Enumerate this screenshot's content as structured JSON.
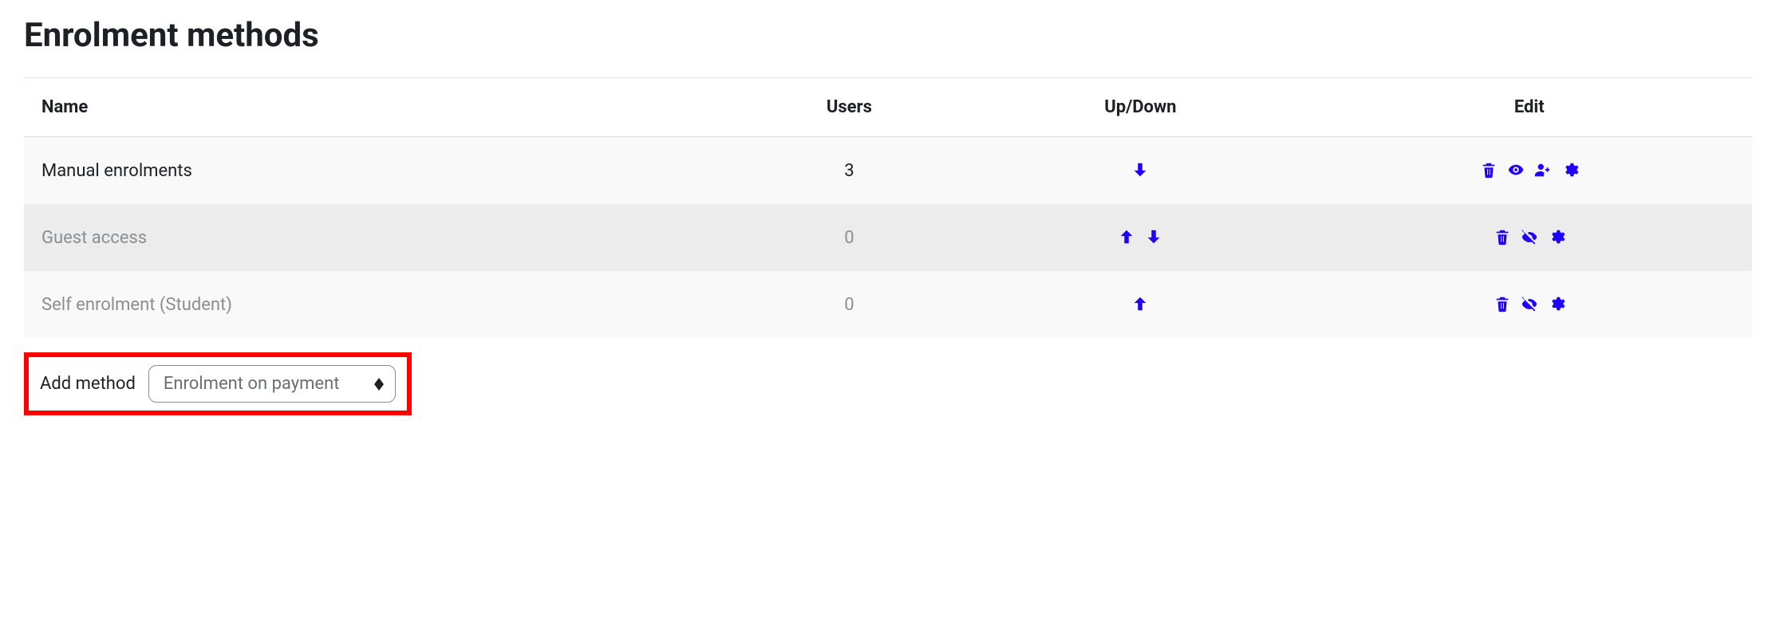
{
  "page": {
    "title": "Enrolment methods"
  },
  "columns": {
    "name": "Name",
    "users": "Users",
    "updown": "Up/Down",
    "edit": "Edit"
  },
  "rows": [
    {
      "name": "Manual enrolments",
      "users": "3",
      "dimmed": false,
      "updown": {
        "up": false,
        "down": true
      },
      "edit": {
        "delete": true,
        "eye": true,
        "eye_hidden": false,
        "enrol_users": true,
        "settings": true
      }
    },
    {
      "name": "Guest access",
      "users": "0",
      "dimmed": true,
      "updown": {
        "up": true,
        "down": true
      },
      "edit": {
        "delete": true,
        "eye": true,
        "eye_hidden": true,
        "enrol_users": false,
        "settings": true
      }
    },
    {
      "name": "Self enrolment (Student)",
      "users": "0",
      "dimmed": true,
      "updown": {
        "up": true,
        "down": false
      },
      "edit": {
        "delete": true,
        "eye": true,
        "eye_hidden": true,
        "enrol_users": false,
        "settings": true
      }
    }
  ],
  "add_method": {
    "label": "Add method",
    "selected": "Enrolment on payment"
  }
}
